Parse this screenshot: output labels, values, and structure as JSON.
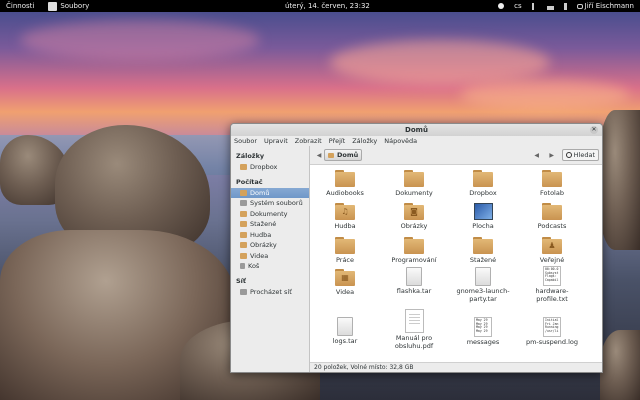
{
  "topbar": {
    "activities": "Činnosti",
    "app_menu": "Soubory",
    "clock": "úterý, 14. červen, 23:32",
    "keyboard": "cs",
    "user": "Jiří Eischmann"
  },
  "window": {
    "title": "Domů",
    "menu": [
      "Soubor",
      "Upravit",
      "Zobrazit",
      "Přejít",
      "Záložky",
      "Nápověda"
    ],
    "breadcrumb": "Domů",
    "search_label": "Hledat",
    "status": "20 položek, Volné místo: 32,8 GB"
  },
  "sidebar": {
    "bookmarks_header": "Záložky",
    "bookmarks": [
      "Dropbox"
    ],
    "computer_header": "Počítač",
    "computer": [
      "Domů",
      "Systém souborů",
      "Dokumenty",
      "Stažené",
      "Hudba",
      "Obrázky",
      "Videa",
      "Koš"
    ],
    "network_header": "Síť",
    "network": [
      "Procházet síť"
    ]
  },
  "files": [
    {
      "name": "Audiobooks",
      "kind": "folder"
    },
    {
      "name": "Dokumenty",
      "kind": "folder"
    },
    {
      "name": "Dropbox",
      "kind": "folder"
    },
    {
      "name": "Fotolab",
      "kind": "folder"
    },
    {
      "name": "Hudba",
      "kind": "folder-music"
    },
    {
      "name": "Obrázky",
      "kind": "folder-pictures"
    },
    {
      "name": "Plocha",
      "kind": "desktop"
    },
    {
      "name": "Podcasts",
      "kind": "folder"
    },
    {
      "name": "Práce",
      "kind": "folder"
    },
    {
      "name": "Programování",
      "kind": "folder"
    },
    {
      "name": "Stažené",
      "kind": "folder"
    },
    {
      "name": "Veřejné",
      "kind": "folder-public"
    },
    {
      "name": "Videa",
      "kind": "folder-videos"
    },
    {
      "name": "flashka.tar",
      "kind": "archive"
    },
    {
      "name": "gnome3-launch-party.tar",
      "kind": "archive"
    },
    {
      "name": "hardware-profile.txt",
      "kind": "text"
    },
    {
      "name": "logs.tar",
      "kind": "archive"
    },
    {
      "name": "Manuál pro obsluhu.pdf",
      "kind": "pdf"
    },
    {
      "name": "messages",
      "kind": "text"
    },
    {
      "name": "pm-suspend.log",
      "kind": "text"
    }
  ],
  "text_previews": {
    "hardware": [
      "00:00.0",
      "Subsyst",
      "Flags:",
      "Capabil"
    ],
    "messages": [
      "May 29",
      "May 29",
      "May 29",
      "May 29"
    ],
    "pmsuspend": [
      "Initial",
      "Fri Jan",
      "Running",
      "/usr/li"
    ]
  },
  "colors": {
    "accent": "#6f97c9",
    "folder": "#d4a25c",
    "topbar": "#000000"
  }
}
